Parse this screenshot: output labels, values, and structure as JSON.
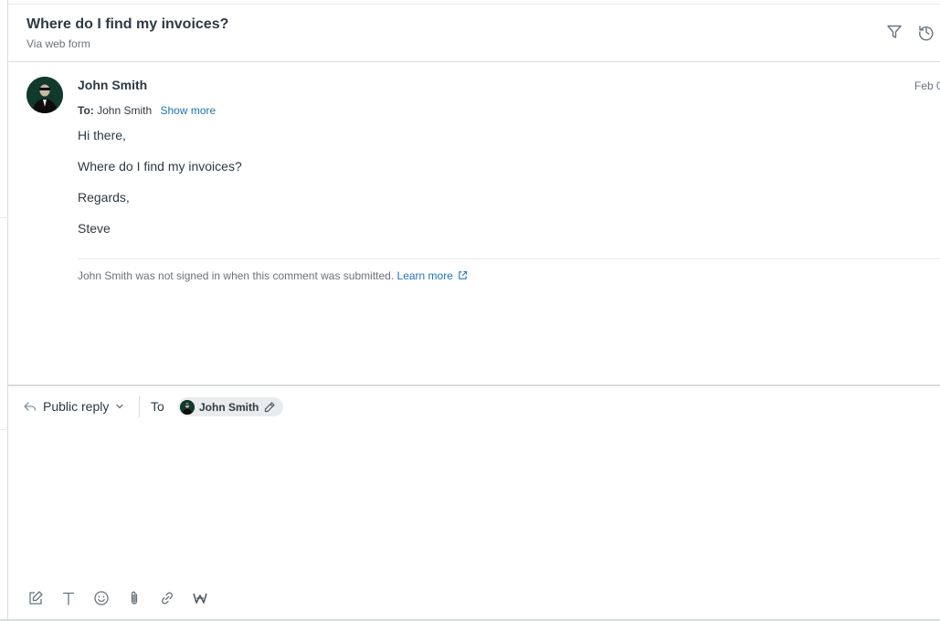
{
  "ticket": {
    "title": "Where do I find my invoices?",
    "channel": "Via web form"
  },
  "header_icons": [
    "filter-icon",
    "history-icon"
  ],
  "message": {
    "author": "John Smith",
    "date": "Feb 0",
    "to_label": "To:",
    "to_value": "John Smith",
    "show_more": "Show more",
    "body": [
      "Hi there,",
      "Where do I find my invoices?",
      "Regards,",
      "Steve"
    ],
    "notice": "John Smith was not signed in when this comment was submitted.",
    "learn_more": "Learn more"
  },
  "composer": {
    "reply_type": "Public reply",
    "to_label": "To",
    "recipient": "John Smith",
    "toolbar": [
      "compose-icon",
      "text-format-icon",
      "emoji-icon",
      "attachment-icon",
      "link-icon",
      "macro-icon"
    ]
  },
  "colors": {
    "link": "#1f73b7",
    "text": "#2f3941",
    "muted": "#68737d",
    "border": "#d8dcde",
    "avatar_bg": "#123a2c"
  }
}
